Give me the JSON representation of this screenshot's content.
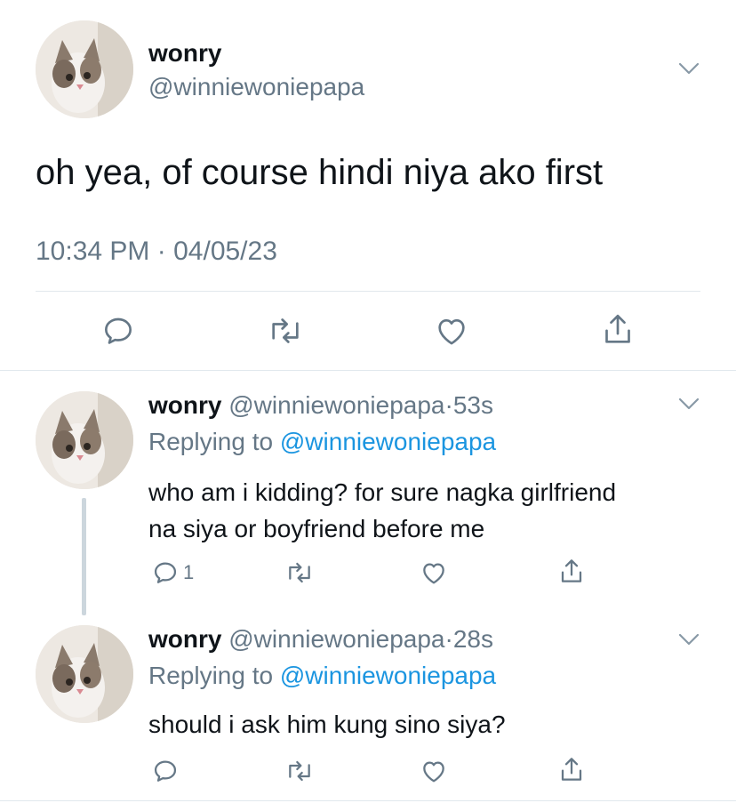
{
  "main_tweet": {
    "display_name": "wonry",
    "handle": "@winniewoniepapa",
    "text": "oh yea, of course hindi niya ako first",
    "time": "10:34 PM",
    "separator": "·",
    "date": "04/05/23"
  },
  "replies": [
    {
      "display_name": "wonry",
      "handle": "@winniewoniepapa",
      "dot": "·",
      "time": "53s",
      "replying_prefix": "Replying to",
      "replying_handle": "@winniewoniepapa",
      "text_line1": "who am i kidding? for sure nagka girlfriend",
      "text_line2": "na siya or boyfriend before me",
      "reply_count": "1"
    },
    {
      "display_name": "wonry",
      "handle": "@winniewoniepapa",
      "dot": "·",
      "time": "28s",
      "replying_prefix": "Replying to",
      "replying_handle": "@winniewoniepapa",
      "text_line1": "should i ask him kung sino siya?",
      "reply_count": ""
    }
  ],
  "colors": {
    "text": "#0f1419",
    "secondary": "#657786",
    "link": "#1b95e0",
    "divider": "#e1e8ed",
    "thread_line": "#ccd6dd"
  },
  "icons": [
    "chevron-down-icon",
    "reply-icon",
    "retweet-icon",
    "like-icon",
    "share-icon"
  ]
}
